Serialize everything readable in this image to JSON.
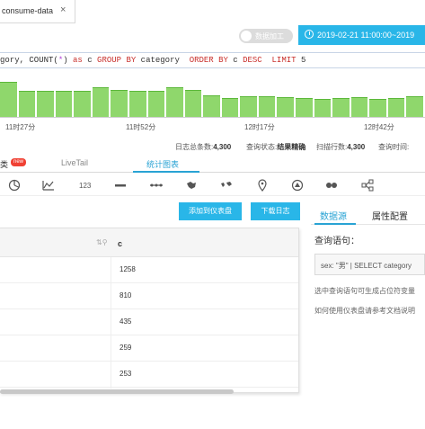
{
  "tab": {
    "label": "consume-data",
    "close": "×"
  },
  "toolbar": {
    "toggle_label": "数据加工",
    "time_range": "2019-02-21 11:00:00~2019"
  },
  "query": {
    "p1": "gory, COUNT(",
    "star": "*",
    "p2": ") ",
    "as": "as",
    "p3": " c ",
    "group_by": "GROUP BY",
    "p4": " category  ",
    "order_by": "ORDER BY",
    "p5": " c ",
    "desc": "DESC",
    "p6": "  ",
    "limit": "LIMIT",
    "p7": " 5"
  },
  "histogram": {
    "values": [
      0.85,
      0.62,
      0.62,
      0.62,
      0.62,
      0.72,
      0.66,
      0.62,
      0.64,
      0.72,
      0.66,
      0.52,
      0.45,
      0.5,
      0.5,
      0.48,
      0.46,
      0.44,
      0.46,
      0.48,
      0.44,
      0.46,
      0.5
    ],
    "ticks": [
      "11时27分",
      "11时52分",
      "12时17分",
      "12时42分"
    ]
  },
  "stats": {
    "total_label": "日志总条数:",
    "total": "4,300",
    "status_label": "查询状态:",
    "status": "结果精确",
    "scan_label": "扫描行数:",
    "scan": "4,300",
    "time_label": "查询时间:"
  },
  "subtabs": {
    "partial": "类",
    "new_badge": "new",
    "livetail": "LiveTail",
    "stats": "统计图表"
  },
  "chart_icons": [
    "pie-chart-icon",
    "area-chart-icon",
    "number-icon",
    "progress-icon",
    "flow-icon",
    "map-icon",
    "world-map-icon",
    "location-icon",
    "sankey-icon",
    "word-cloud-icon",
    "tree-icon"
  ],
  "icon_123": "123",
  "buttons": {
    "add_dashboard": "添加到仪表盘",
    "download": "下载日志"
  },
  "table": {
    "col": "c",
    "rows": [
      "1258",
      "810",
      "435",
      "259",
      "253"
    ]
  },
  "right_panel": {
    "tab_source": "数据源",
    "tab_props": "属性配置",
    "query_label": "查询语句：",
    "query_value": "sex: \"男\" | SELECT category",
    "note1": "选中查询语句可生成占位符变量",
    "note2": "如何使用仪表盘请参考文档说明"
  }
}
